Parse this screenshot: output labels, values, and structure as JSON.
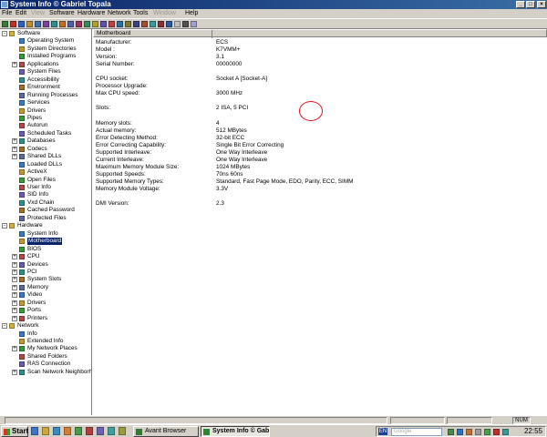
{
  "window": {
    "title": "System Info  © Gabriel Topala"
  },
  "menus": [
    "File",
    "Edit",
    "View",
    "Software",
    "Hardware",
    "Network",
    "Tools",
    "Window",
    "Help"
  ],
  "disabled_menus": [
    "View",
    "Window"
  ],
  "toolbar": {
    "icon_colors": [
      "#3a7a3a",
      "#c03030",
      "#3060c0",
      "#c09030",
      "#4070b0",
      "#8040a0",
      "#2f8f8f",
      "#c07020",
      "#5060a0",
      "#a03060",
      "#3a8a5a",
      "#b0a030",
      "#6050b0",
      "#c04040",
      "#2f6fa0",
      "#7a7a30",
      "#404080",
      "#a05030",
      "#3a9a9a",
      "#8a3030",
      "#2a5aa0",
      "#c0c0c0",
      "#505050",
      "#a0a0d0"
    ]
  },
  "tree": {
    "software": {
      "label": "Software",
      "items": [
        "Operating System",
        "System Directories",
        "Installed Programs",
        "Applications",
        "System Files",
        "Accessibility",
        "Environment",
        "Running Processes",
        "Services",
        "Drivers",
        "Pipes",
        "Autorun",
        "Scheduled Tasks",
        "Databases",
        "Codecs",
        "Shared DLLs",
        "Loaded DLLs",
        "ActiveX",
        "Open Files",
        "User Info",
        "SID Info",
        "Vxd Chain",
        "Cached Password",
        "Protected Files"
      ]
    },
    "hardware": {
      "label": "Hardware",
      "items": [
        "System Info",
        "Motherboard",
        "BIOS",
        "CPU",
        "Devices",
        "PCI",
        "System Slots",
        "Memory",
        "Video",
        "Drivers",
        "Ports",
        "Printers"
      ],
      "selected": "Motherboard"
    },
    "network": {
      "label": "Network",
      "items": [
        "Info",
        "Extended Info",
        "My Network Places",
        "Shared Folders",
        "RAS Connection",
        "Scan Network Neighborhood"
      ]
    }
  },
  "details": {
    "header": "Motherboard",
    "rows": [
      {
        "k": "Manufacturer:",
        "v": "ECS"
      },
      {
        "k": "Model :",
        "v": "K7VMM+"
      },
      {
        "k": "Version:",
        "v": "3.1"
      },
      {
        "k": "Serial Number:",
        "v": "00000000"
      },
      {
        "k": "",
        "v": ""
      },
      {
        "k": "CPU socket:",
        "v": "Socket A [Socket-A]"
      },
      {
        "k": "Processor Upgrade:",
        "v": ""
      },
      {
        "k": "Max CPU speed:",
        "v": "3000 MHz"
      },
      {
        "k": "",
        "v": ""
      },
      {
        "k": "Slots:",
        "v": "2 ISA, 5 PCI"
      },
      {
        "k": "",
        "v": ""
      },
      {
        "k": "Memory slots:",
        "v": "4"
      },
      {
        "k": "Actual memory:",
        "v": "512 MBytes"
      },
      {
        "k": "Error Detecting Method:",
        "v": "32-bit ECC"
      },
      {
        "k": "Error Correcting Capability:",
        "v": "Single Bit Error Correcting"
      },
      {
        "k": "Supported Interleave:",
        "v": "One Way Interleave"
      },
      {
        "k": "Current Interleave:",
        "v": "One Way Interleave"
      },
      {
        "k": "Maximum Memory Module Size:",
        "v": "1024 MBytes"
      },
      {
        "k": "Supported Speeds:",
        "v": "70ns 60ns"
      },
      {
        "k": "Supported Memory Types:",
        "v": "Standard, Fast Page Mode, EDO, Parity, ECC, SIMM"
      },
      {
        "k": "Memory Module Voltage:",
        "v": "3.3V"
      },
      {
        "k": "",
        "v": ""
      },
      {
        "k": "DMI Version:",
        "v": "2.3"
      }
    ]
  },
  "statusbar": {
    "num": "NUM"
  },
  "taskbar": {
    "start": "Start",
    "tasks": [
      {
        "label": "Avant Browser",
        "active": false,
        "icon_color": "#2e7a2e"
      },
      {
        "label": "System Info  © Gab...",
        "active": true,
        "icon_color": "#2a8a2a"
      }
    ],
    "lang": "EN",
    "clock": "22:55"
  }
}
